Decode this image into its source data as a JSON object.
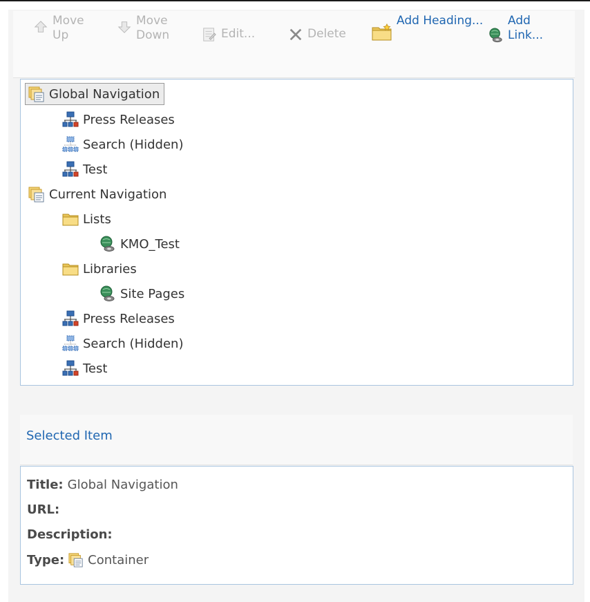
{
  "toolbar": {
    "move_up": "Move Up",
    "move_down": "Move Down",
    "edit": "Edit...",
    "delete": "Delete",
    "add_heading": "Add Heading...",
    "add_link": "Add Link..."
  },
  "tree": {
    "nodes": [
      {
        "label": "Global Navigation",
        "icon": "container-icon"
      },
      {
        "label": "Press Releases",
        "icon": "site-icon"
      },
      {
        "label": "Search (Hidden)",
        "icon": "hidden-site-icon"
      },
      {
        "label": "Test",
        "icon": "site-icon"
      },
      {
        "label": "Current Navigation",
        "icon": "container-icon"
      },
      {
        "label": "Lists",
        "icon": "folder-icon"
      },
      {
        "label": "KMO_Test",
        "icon": "link-icon"
      },
      {
        "label": "Libraries",
        "icon": "folder-icon"
      },
      {
        "label": "Site Pages",
        "icon": "link-icon"
      },
      {
        "label": "Press Releases",
        "icon": "site-icon"
      },
      {
        "label": "Search (Hidden)",
        "icon": "hidden-site-icon"
      },
      {
        "label": "Test",
        "icon": "site-icon"
      }
    ]
  },
  "selected": {
    "header": "Selected Item",
    "title_label": "Title:",
    "title_value": "Global Navigation",
    "url_label": "URL:",
    "url_value": "",
    "description_label": "Description:",
    "description_value": "",
    "type_label": "Type:",
    "type_value": "Container"
  },
  "colors": {
    "accent": "#1f66b1",
    "border": "#a8c4df",
    "disabled": "#b4b4b4"
  }
}
